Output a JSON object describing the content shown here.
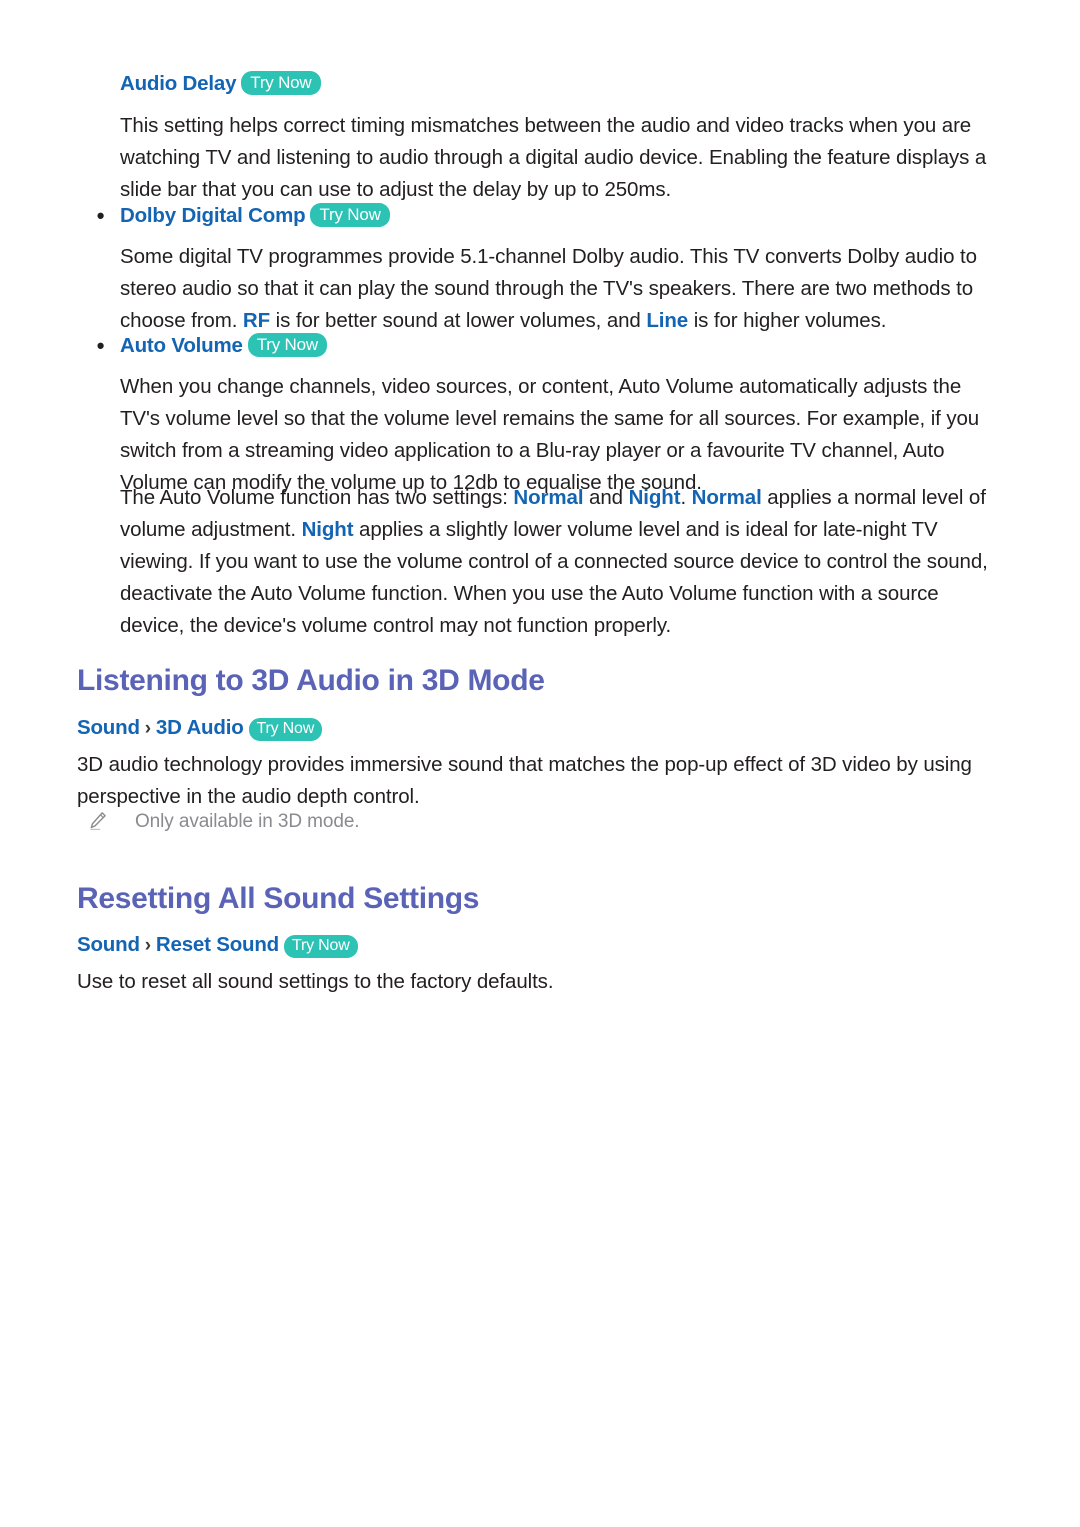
{
  "page": {
    "background": "#ffffff",
    "body_text_color": "#231f20",
    "link_color": "#1464b4",
    "section_title_color": "#5b63b7",
    "badge_color": "#2cc2b4",
    "note_color": "#8a8a8f"
  },
  "try_now_label": "Try Now",
  "items": [
    {
      "id": "audio-delay",
      "bullet": "",
      "title": "Audio Delay",
      "try_now": "Try Now",
      "paragraphs": [
        "This setting helps correct timing mismatches between the audio and video tracks when you are watching TV and listening to audio through a digital audio device. Enabling the feature displays a slide bar that you can use to adjust the delay by up to 250ms."
      ]
    },
    {
      "id": "dolby-digital-comp",
      "bullet": "•",
      "title": "Dolby Digital Comp",
      "try_now": "Try Now",
      "paragraph_parts": [
        {
          "text": "Some digital TV programmes provide 5.1-channel Dolby audio. This TV converts Dolby audio to stereo audio so that it can play the sound through the TV's speakers. There are two methods to choose from. ",
          "kw": false
        },
        {
          "text": "RF",
          "kw": true
        },
        {
          "text": " is for better sound at lower volumes, and ",
          "kw": false
        },
        {
          "text": "Line",
          "kw": true
        },
        {
          "text": " is for higher volumes.",
          "kw": false
        }
      ]
    },
    {
      "id": "auto-volume",
      "bullet": "•",
      "title": "Auto Volume",
      "try_now": "Try Now",
      "paragraphs": [
        "When you change channels, video sources, or content, Auto Volume automatically adjusts the TV's volume level so that the volume level remains the same for all sources. For example, if you switch from a streaming video application to a Blu-ray player or a favourite TV channel, Auto Volume can modify the volume up to 12db to equalise the sound."
      ],
      "paragraph2_parts": [
        {
          "text": "The Auto Volume function has two settings: ",
          "kw": false
        },
        {
          "text": "Normal",
          "kw": true
        },
        {
          "text": " and ",
          "kw": false
        },
        {
          "text": "Night",
          "kw": true
        },
        {
          "text": ". ",
          "kw": false
        },
        {
          "text": "Normal",
          "kw": true
        },
        {
          "text": " applies a normal level of volume adjustment. ",
          "kw": false
        },
        {
          "text": "Night",
          "kw": true
        },
        {
          "text": " applies a slightly lower volume level and is ideal for late-night TV viewing. If you want to use the volume control of a connected source device to control the sound, deactivate the Auto Volume function. When you use the Auto Volume function with a source device, the device's volume control may not function properly.",
          "kw": false
        }
      ]
    }
  ],
  "sections": [
    {
      "id": "listening-3d-audio",
      "title": "Listening to 3D Audio in 3D Mode",
      "breadcrumb": {
        "root": "Sound",
        "separator": "›",
        "leaf": "3D Audio",
        "try_now": "Try Now"
      },
      "body": "3D audio technology provides immersive sound that matches the pop-up effect of 3D video by using perspective in the audio depth control.",
      "note": {
        "icon": "pencil-icon",
        "text": "Only available in 3D mode."
      }
    },
    {
      "id": "resetting-all-sound-settings",
      "title": "Resetting All Sound Settings",
      "breadcrumb": {
        "root": "Sound",
        "separator": "›",
        "leaf": "Reset Sound",
        "try_now": "Try Now"
      },
      "body": "Use to reset all sound settings to the factory defaults."
    }
  ]
}
